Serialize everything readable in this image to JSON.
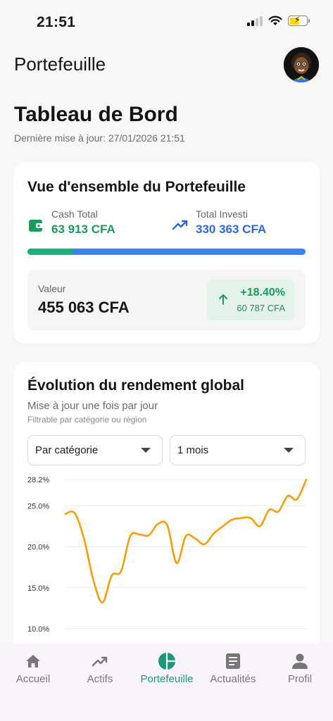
{
  "status_bar": {
    "time": "21:51"
  },
  "header": {
    "title": "Portefeuille"
  },
  "dashboard": {
    "title": "Tableau de Bord",
    "last_update": "Dernière mise à jour: 27/01/2026 21:51"
  },
  "overview": {
    "title": "Vue d'ensemble du Portefeuille",
    "cash_label": "Cash Total",
    "cash_value": "63 913 CFA",
    "invested_label": "Total Investi",
    "invested_value": "330 363 CFA",
    "cash_ratio": 0.162,
    "value_label": "Valeur",
    "value_amount": "455 063 CFA",
    "gain_percent": "+18.40%",
    "gain_amount": "60 787 CFA",
    "colors": {
      "cash": "#16b27a",
      "invested": "#3b82f6",
      "gain": "#1a9a5c"
    }
  },
  "evolution": {
    "title": "Évolution du rendement global",
    "subtitle": "Mise à jour une fois par jour",
    "hint": "Filtrable par catégorie ou région",
    "category_select": "Par catégorie",
    "period_select": "1 mois"
  },
  "chart_data": {
    "type": "line",
    "title": "",
    "xlabel": "",
    "ylabel": "",
    "y_tick_labels": [
      "28.2%",
      "25.0%",
      "20.0%",
      "15.0%",
      "10.0%"
    ],
    "y_ticks": [
      28.2,
      25.0,
      20.0,
      15.0,
      10.0
    ],
    "ylim": [
      10.0,
      28.2
    ],
    "grid": true,
    "color": "#f59e0b",
    "series": [
      {
        "values": [
          24.0,
          24.1,
          21.0,
          16.0,
          13.2,
          16.5,
          17.0,
          21.3,
          21.5,
          21.4,
          22.8,
          22.6,
          18.0,
          21.3,
          21.0,
          20.3,
          21.6,
          22.5,
          23.3,
          23.5,
          23.5,
          22.5,
          24.5,
          24.3,
          26.2,
          25.8,
          28.2
        ]
      }
    ]
  },
  "nav": {
    "items": [
      {
        "label": "Accueil",
        "icon": "home-icon"
      },
      {
        "label": "Actifs",
        "icon": "trending-up-icon"
      },
      {
        "label": "Portefeuille",
        "icon": "pie-chart-icon",
        "active": true
      },
      {
        "label": "Actualités",
        "icon": "article-icon"
      },
      {
        "label": "Profil",
        "icon": "person-icon"
      }
    ],
    "active_color": "#1a9a7a"
  }
}
